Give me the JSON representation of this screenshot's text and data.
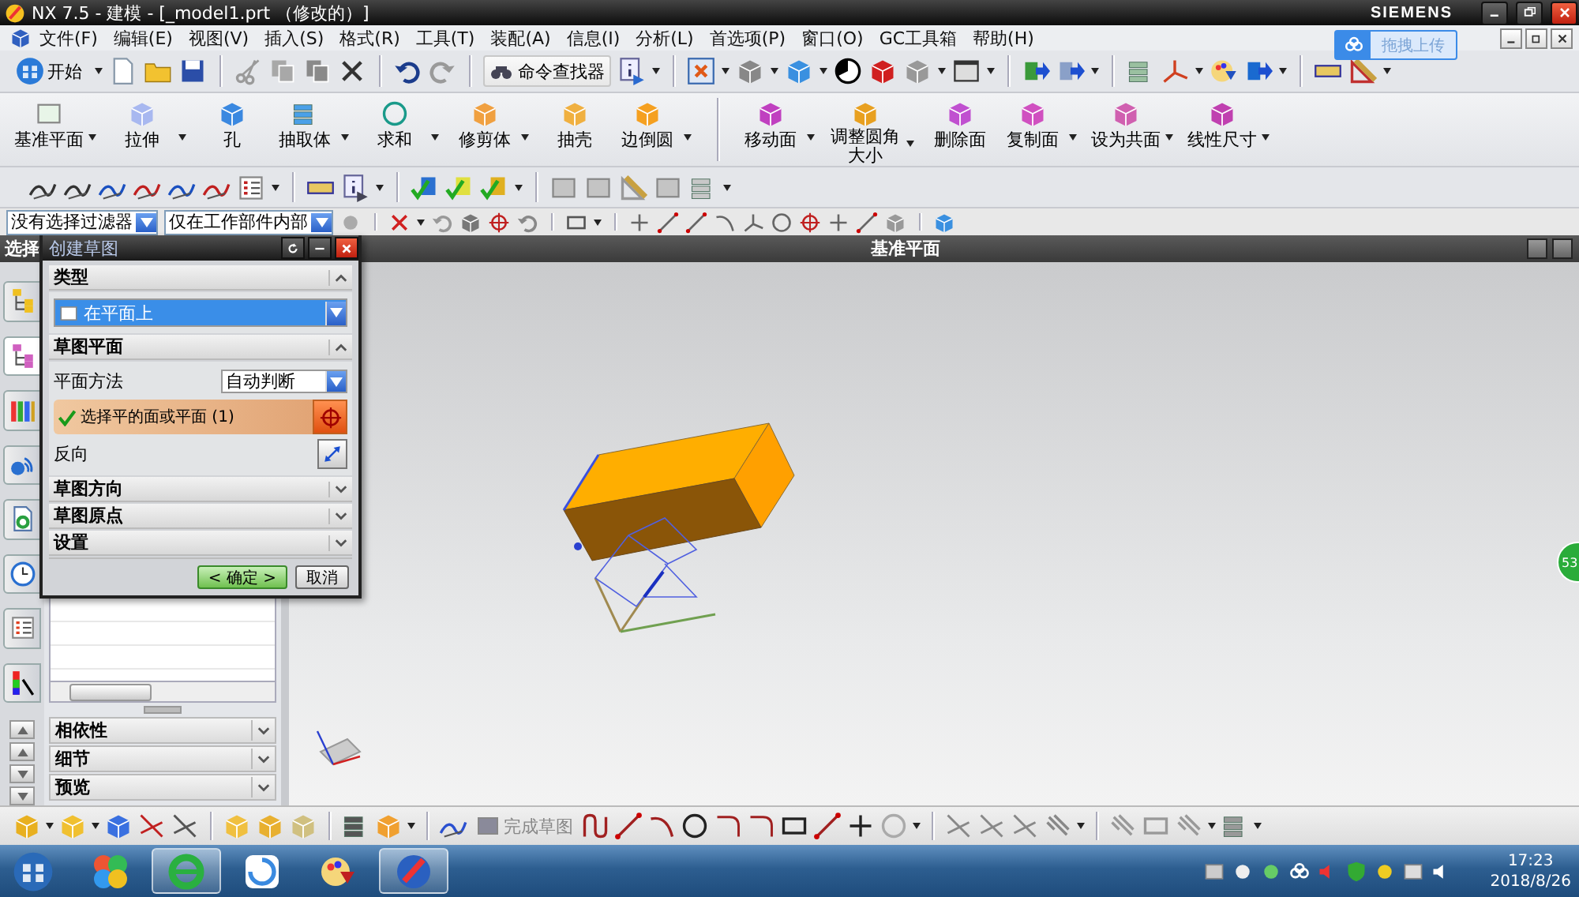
{
  "window": {
    "title": "NX 7.5 - 建模 - [_model1.prt （修改的）]",
    "brand": "SIEMENS"
  },
  "menu": [
    {
      "label": "文件(F)"
    },
    {
      "label": "编辑(E)"
    },
    {
      "label": "视图(V)"
    },
    {
      "label": "插入(S)"
    },
    {
      "label": "格式(R)"
    },
    {
      "label": "工具(T)"
    },
    {
      "label": "装配(A)"
    },
    {
      "label": "信息(I)"
    },
    {
      "label": "分析(L)"
    },
    {
      "label": "首选项(P)"
    },
    {
      "label": "窗口(O)"
    },
    {
      "label": "GC工具箱"
    },
    {
      "label": "帮助(H)"
    }
  ],
  "upload_button": "拖拽上传",
  "standard_toolbar": {
    "start": "开始",
    "command_finder": "命令查找器"
  },
  "feature_toolbar": [
    {
      "label": "基准平面",
      "dropdown": true
    },
    {
      "label": "拉伸",
      "dropdown": true
    },
    {
      "label": "孔",
      "dropdown": false
    },
    {
      "label": "抽取体",
      "dropdown": true
    },
    {
      "label": "求和",
      "dropdown": true
    },
    {
      "label": "修剪体",
      "dropdown": true
    },
    {
      "label": "抽壳",
      "dropdown": false
    },
    {
      "label": "边倒圆",
      "dropdown": true
    }
  ],
  "sync_toolbar": [
    {
      "label": "移动面",
      "dropdown": true
    },
    {
      "label": "调整圆角大小",
      "dropdown": true
    },
    {
      "label": "删除面",
      "dropdown": false
    },
    {
      "label": "复制面",
      "dropdown": true
    },
    {
      "label": "设为共面",
      "dropdown": true
    },
    {
      "label": "线性尺寸",
      "dropdown": true
    }
  ],
  "selection_bar": {
    "filter": "没有选择过滤器",
    "scope": "仅在工作部件内部"
  },
  "navigator": {
    "title": "选择",
    "panels": [
      {
        "label": "相依性",
        "expanded": false
      },
      {
        "label": "细节",
        "expanded": false
      },
      {
        "label": "预览",
        "expanded": false
      }
    ]
  },
  "resource_tabs": [
    {
      "selected": false
    },
    {
      "selected": true
    },
    {
      "selected": false
    },
    {
      "selected": false
    },
    {
      "selected": false
    },
    {
      "selected": false
    },
    {
      "selected": false
    },
    {
      "selected": false
    }
  ],
  "viewport": {
    "title": "基准平面"
  },
  "dialog": {
    "title": "创建草图",
    "sections": [
      {
        "kind": "type",
        "label": "类型",
        "expanded": true,
        "value": "在平面上"
      },
      {
        "kind": "plane",
        "label": "草图平面",
        "expanded": true,
        "method_label": "平面方法",
        "method_value": "自动判断",
        "select_label": "选择平的面或平面 (1)",
        "select_done": true,
        "reverse_label": "反向"
      },
      {
        "kind": "collapsed",
        "label": "草图方向",
        "expanded": false
      },
      {
        "kind": "collapsed",
        "label": "草图原点",
        "expanded": false
      },
      {
        "kind": "collapsed",
        "label": "设置",
        "expanded": false
      }
    ],
    "buttons": [
      {
        "label": "< 确定 >",
        "default": true
      },
      {
        "label": "取消",
        "default": false
      }
    ]
  },
  "sketch_toolbar": {
    "finish": "完成草图"
  },
  "side_badge": "53",
  "taskbar": {
    "apps": [
      {
        "selected": false
      },
      {
        "selected": true
      },
      {
        "selected": false
      },
      {
        "selected": false
      },
      {
        "selected": true
      }
    ],
    "time": "17:23",
    "date": "2018/8/26"
  }
}
